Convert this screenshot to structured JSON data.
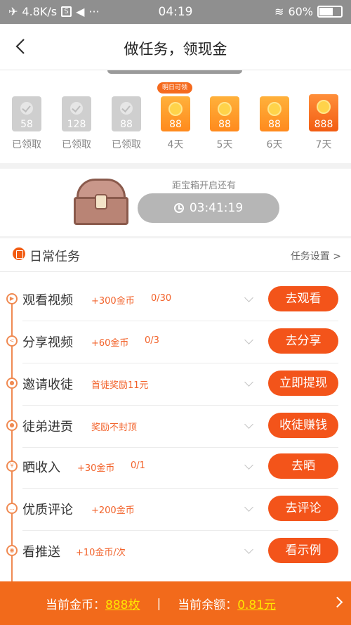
{
  "status_bar": {
    "speed": "4.8K/s",
    "time": "04:19",
    "battery": "60%"
  },
  "header": {
    "title": "做任务，领现金"
  },
  "checkin": {
    "tag": "明日可领",
    "days": [
      {
        "value": "58",
        "label": "已领取",
        "state": "claimed"
      },
      {
        "value": "128",
        "label": "已领取",
        "state": "claimed"
      },
      {
        "value": "88",
        "label": "已领取",
        "state": "claimed"
      },
      {
        "value": "88",
        "label": "4天",
        "state": "pending"
      },
      {
        "value": "88",
        "label": "5天",
        "state": "pending"
      },
      {
        "value": "88",
        "label": "6天",
        "state": "pending"
      },
      {
        "value": "888",
        "label": "7天",
        "state": "big"
      }
    ]
  },
  "treasure": {
    "caption": "距宝箱开启还有",
    "countdown": "03:41:19"
  },
  "daily": {
    "title": "日常任务",
    "settings": "任务设置 >"
  },
  "tasks": [
    {
      "name": "观看视频",
      "reward": "+300金币",
      "progress": "0/30",
      "button": "去观看",
      "icon": "play-icon"
    },
    {
      "name": "分享视频",
      "reward": "+60金币",
      "progress": "0/3",
      "button": "去分享",
      "icon": "share-icon"
    },
    {
      "name": "邀请收徒",
      "reward": "首徒奖励11元",
      "progress": "",
      "button": "立即提现",
      "icon": "user-icon"
    },
    {
      "name": "徒弟进贡",
      "reward": "奖励不封顶",
      "progress": "",
      "button": "收徒赚钱",
      "icon": "user-icon"
    },
    {
      "name": "晒收入",
      "reward": "+30金币",
      "progress": "0/1",
      "button": "去晒",
      "icon": "yen-icon"
    },
    {
      "name": "优质评论",
      "reward": "+200金币",
      "progress": "",
      "button": "去评论",
      "icon": "comment-icon"
    },
    {
      "name": "看推送",
      "reward": "+10金币/次",
      "progress": "",
      "button": "看示例",
      "icon": "eye-icon"
    }
  ],
  "bottom": {
    "coins_label": "当前金币：",
    "coins_value": "888枚",
    "separator": "|",
    "balance_label": "当前余额：",
    "balance_value": "0.81元"
  },
  "colors": {
    "accent": "#f3541a",
    "gold": "#ffe600"
  }
}
